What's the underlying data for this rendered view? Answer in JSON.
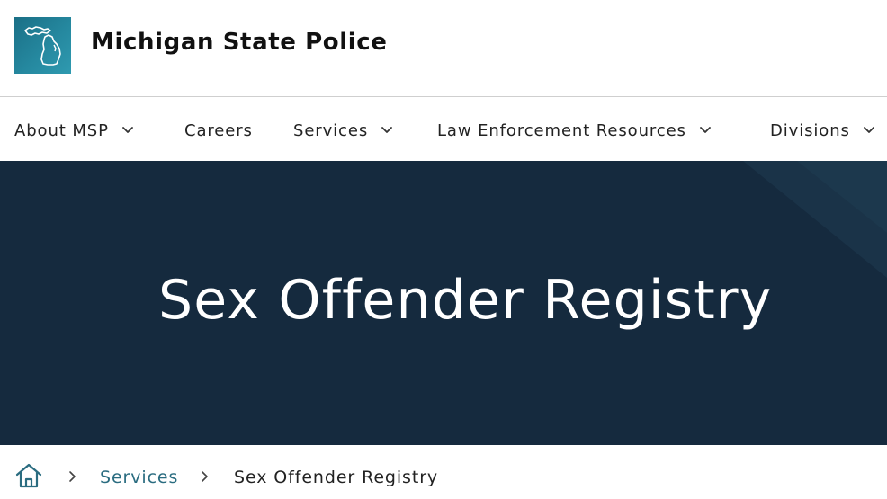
{
  "header": {
    "site_title": "Michigan State Police",
    "logo_icon": "michigan-map-icon",
    "brand_color": "#25889f"
  },
  "nav": {
    "items": [
      {
        "label": "About MSP",
        "has_dropdown": true
      },
      {
        "label": "Careers",
        "has_dropdown": false
      },
      {
        "label": "Services",
        "has_dropdown": true
      },
      {
        "label": "Law Enforcement Resources",
        "has_dropdown": true
      },
      {
        "label": "Divisions",
        "has_dropdown": true
      }
    ]
  },
  "hero": {
    "title": "Sex Offender Registry",
    "background_color": "#152a3e"
  },
  "breadcrumb": {
    "home_icon": "home-icon",
    "items": [
      {
        "label": "Services",
        "is_link": true
      },
      {
        "label": "Sex Offender Registry",
        "is_link": false
      }
    ],
    "link_color": "#2a6c80"
  }
}
